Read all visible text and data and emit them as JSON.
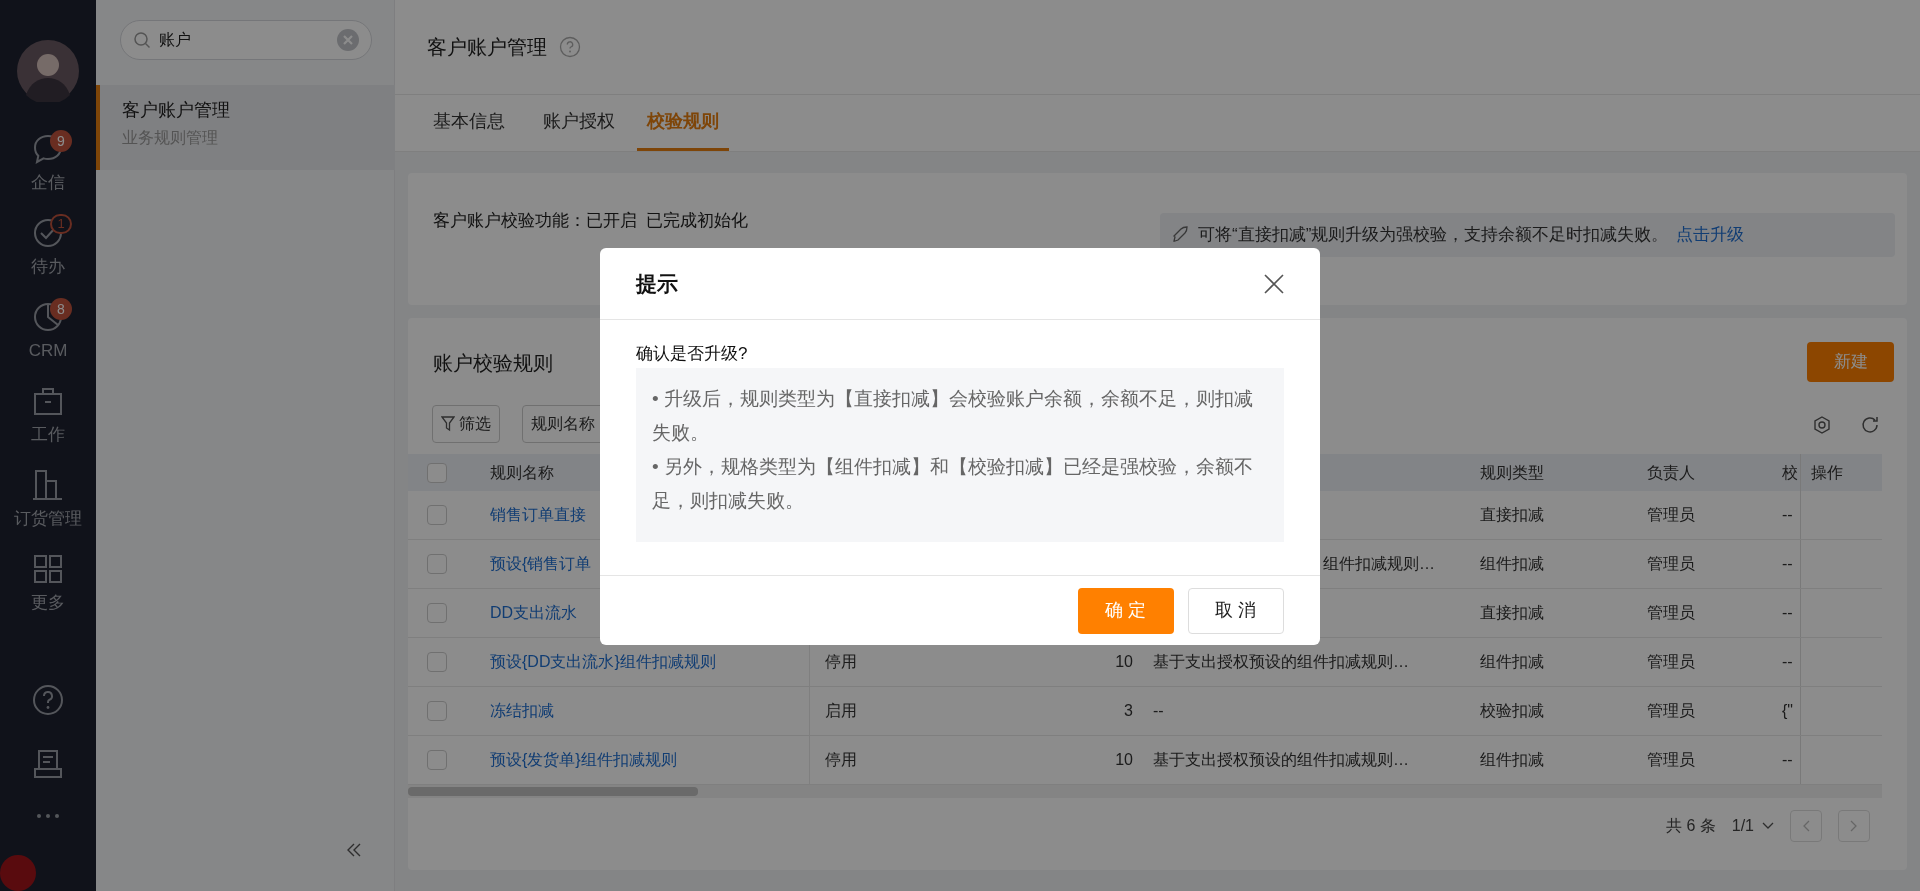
{
  "nav": {
    "items": [
      {
        "kind": "chat",
        "label": "企信",
        "badge": "9",
        "badge_outline": false
      },
      {
        "kind": "check",
        "label": "待办",
        "badge": "1",
        "badge_outline": true
      },
      {
        "kind": "pie",
        "label": "CRM",
        "badge": "8",
        "badge_outline": false
      },
      {
        "kind": "briefcase",
        "label": "工作"
      },
      {
        "kind": "building",
        "label": "订货管理"
      },
      {
        "kind": "grid",
        "label": "更多"
      }
    ],
    "bottom": [
      {
        "kind": "help"
      },
      {
        "kind": "inbox"
      },
      {
        "kind": "more"
      }
    ]
  },
  "search": {
    "value": "账户"
  },
  "menu": [
    {
      "title": "客户账户管理",
      "subtitle": "业务规则管理",
      "selected": true
    }
  ],
  "page": {
    "title": "客户账户管理"
  },
  "tabs": [
    {
      "label": "基本信息",
      "selected": false
    },
    {
      "label": "账户授权",
      "selected": false
    },
    {
      "label": "校验规则",
      "selected": true
    }
  ],
  "status_text": "客户账户校验功能：已开启  已完成初始化",
  "notice": {
    "text": "可将“直接扣减”规则升级为强校验，支持余额不足时扣减失败。",
    "link": "点击升级"
  },
  "rules": {
    "title": "账户校验规则",
    "new_button": "新建",
    "filter_button": "筛选",
    "field_select": "规则名称",
    "all_checked": false,
    "columns": [
      "规则名称",
      "",
      "",
      "",
      "规则类型",
      "负责人",
      "校",
      "操作"
    ],
    "rows": [
      {
        "checked": false,
        "name": "销售订单直接",
        "status": "",
        "count": "",
        "desc": "",
        "type": "直接扣减",
        "owner": "管理员",
        "col_7": "--"
      },
      {
        "checked": false,
        "name": "预设{销售订单",
        "status": "",
        "count": "",
        "desc": "组件扣减规则…",
        "type": "组件扣减",
        "owner": "管理员",
        "col_7": "--"
      },
      {
        "checked": false,
        "name": "DD支出流水",
        "status": "",
        "count": "",
        "desc": "",
        "type": "直接扣减",
        "owner": "管理员",
        "col_7": "--"
      },
      {
        "checked": false,
        "name": "预设{DD支出流水}组件扣减规则",
        "status": "停用",
        "count": "10",
        "desc": "基于支出授权预设的组件扣减规则…",
        "type": "组件扣减",
        "owner": "管理员",
        "col_7": "--"
      },
      {
        "checked": false,
        "name": "冻结扣减",
        "status": "启用",
        "count": "3",
        "desc": "--",
        "type": "校验扣减",
        "owner": "管理员",
        "col_7": "{\""
      },
      {
        "checked": false,
        "name": "预设{发货单}组件扣减规则",
        "status": "停用",
        "count": "10",
        "desc": "基于支出授权预设的组件扣减规则…",
        "type": "组件扣减",
        "owner": "管理员",
        "col_7": "--"
      }
    ],
    "total": "共 6 条",
    "page": "1/1"
  },
  "dialog": {
    "title": "提示",
    "question": "确认是否升级?",
    "points": [
      "• 升级后，规则类型为【直接扣减】会校验账户余额，余额不足，则扣减失败。",
      "• 另外，规格类型为【组件扣减】和【校验扣减】已经是强校验，余额不足，则扣减失败。"
    ],
    "ok": "确 定",
    "cancel": "取 消"
  }
}
